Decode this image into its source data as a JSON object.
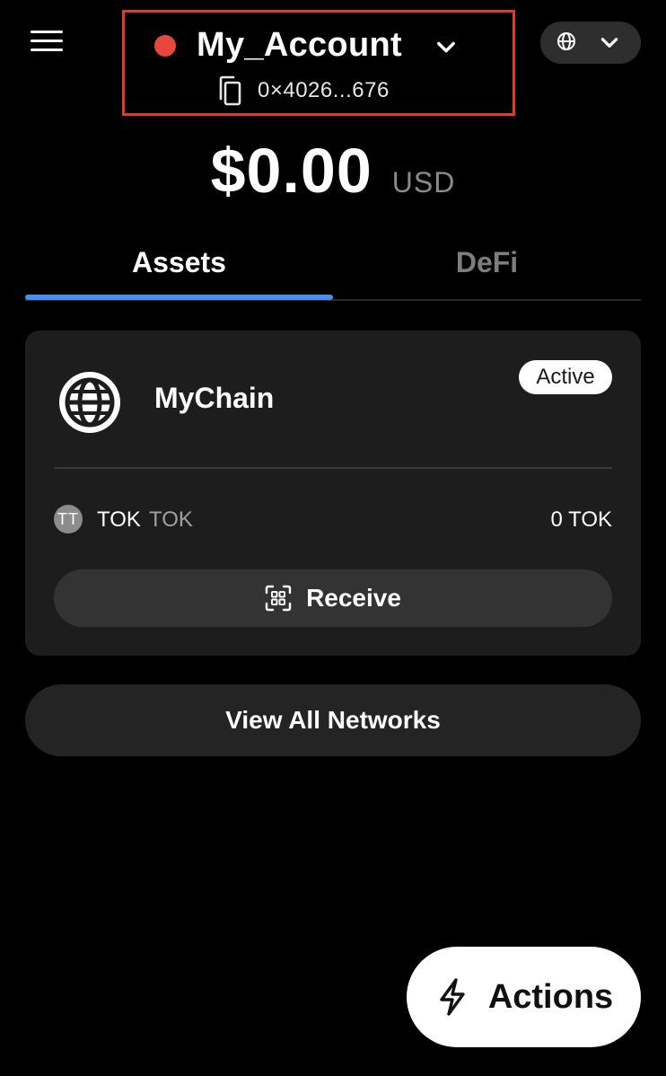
{
  "header": {
    "menu_icon": "hamburger-menu-icon",
    "account_name": "My_Account",
    "account_status_color": "#e8473d",
    "account_chevron_icon": "chevron-down-icon",
    "copy_icon": "copy-icon",
    "address": "0×4026...676",
    "network_selector": {
      "icon": "globe-icon",
      "chevron_icon": "chevron-down-icon"
    }
  },
  "balance": {
    "amount": "$0.00",
    "currency": "USD"
  },
  "tabs": [
    {
      "label": "Assets",
      "active": true
    },
    {
      "label": "DeFi",
      "active": false
    }
  ],
  "network_card": {
    "chain_icon": "globe-icon",
    "chain_name": "MyChain",
    "status_badge": "Active",
    "token": {
      "avatar_text": "TT",
      "symbol": "TOK",
      "name": "TOK",
      "balance": "0 TOK"
    },
    "receive_icon": "qr-scan-icon",
    "receive_label": "Receive"
  },
  "view_all_label": "View All Networks",
  "actions": {
    "icon": "lightning-bolt-icon",
    "label": "Actions"
  },
  "colors": {
    "background": "#000000",
    "card": "#1d1d1d",
    "accent_tab": "#4a8ef0",
    "highlight_border": "#e03a2f"
  }
}
